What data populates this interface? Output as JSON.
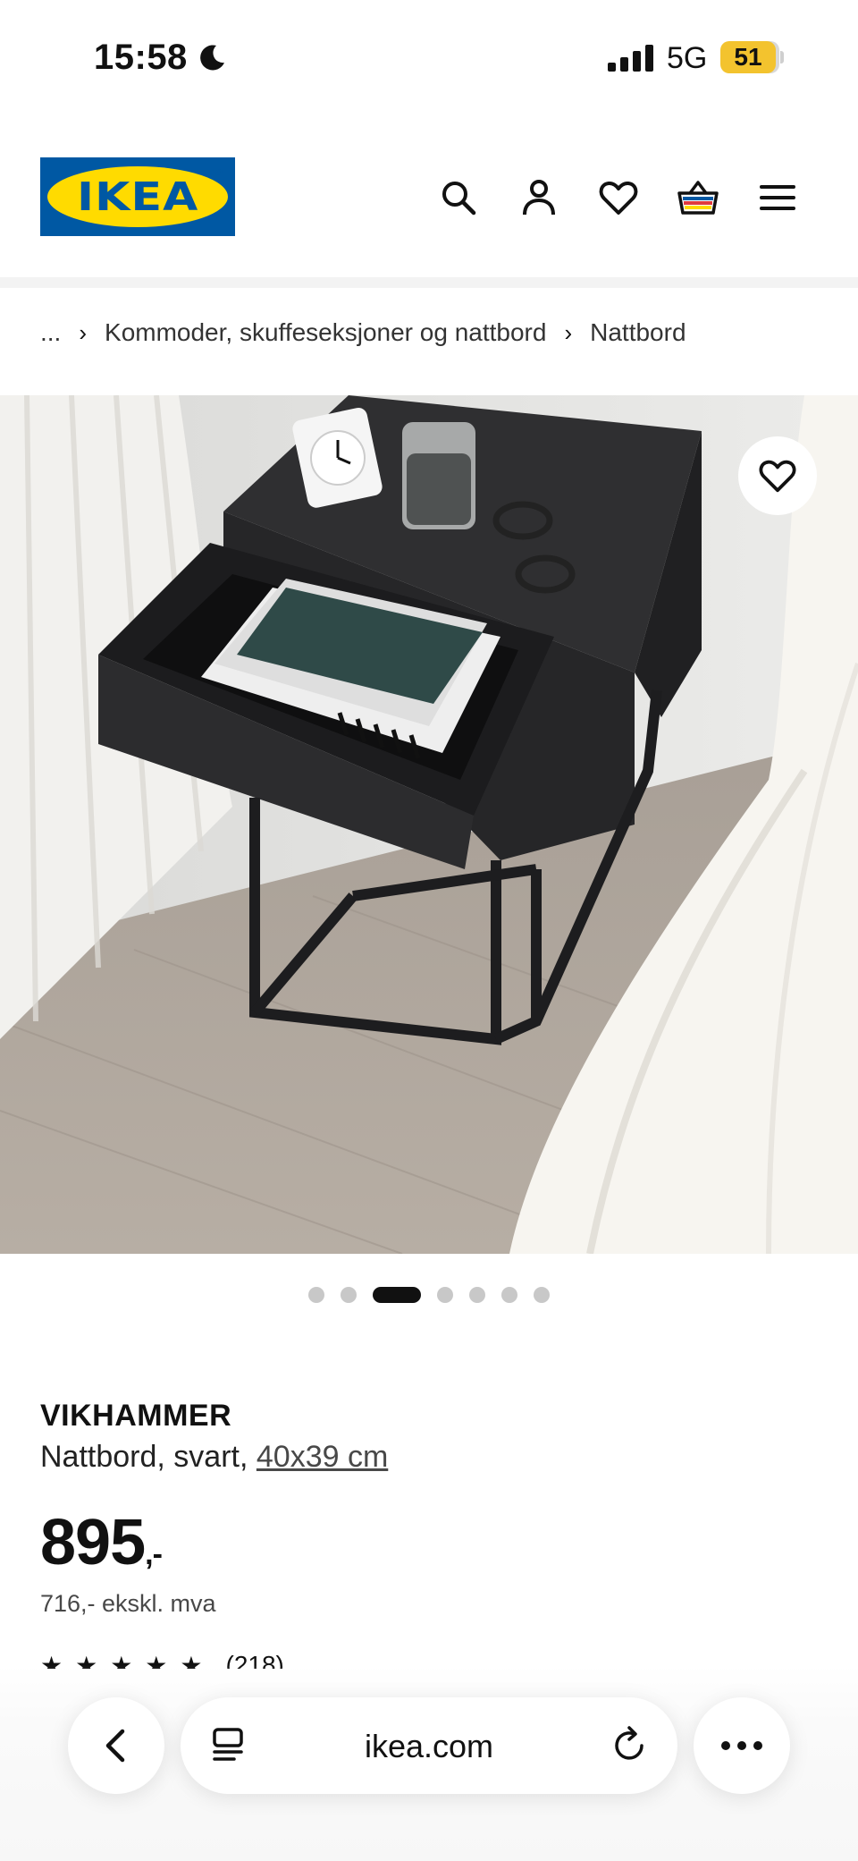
{
  "status_bar": {
    "time": "15:58",
    "network": "5G",
    "battery": "51"
  },
  "header": {
    "logo_text": "IKEA",
    "icons": [
      "search-icon",
      "profile-icon",
      "heart-icon",
      "basket-icon",
      "menu-icon"
    ]
  },
  "breadcrumb": {
    "ellipsis": "...",
    "items": [
      "Kommoder, skuffeseksjoner og nattbord",
      "Nattbord"
    ]
  },
  "carousel": {
    "total": 7,
    "active_index": 2
  },
  "product": {
    "name": "VIKHAMMER",
    "description": "Nattbord, svart,",
    "size_link": "40x39 cm",
    "price": "895",
    "price_suffix": ",-",
    "price_excl": "716,- ekskl. mva",
    "rating_count": "(218)"
  },
  "browser": {
    "url": "ikea.com"
  },
  "colors": {
    "ikea_blue": "#0058a3",
    "ikea_yellow": "#ffdb00",
    "battery": "#f3c32e"
  }
}
